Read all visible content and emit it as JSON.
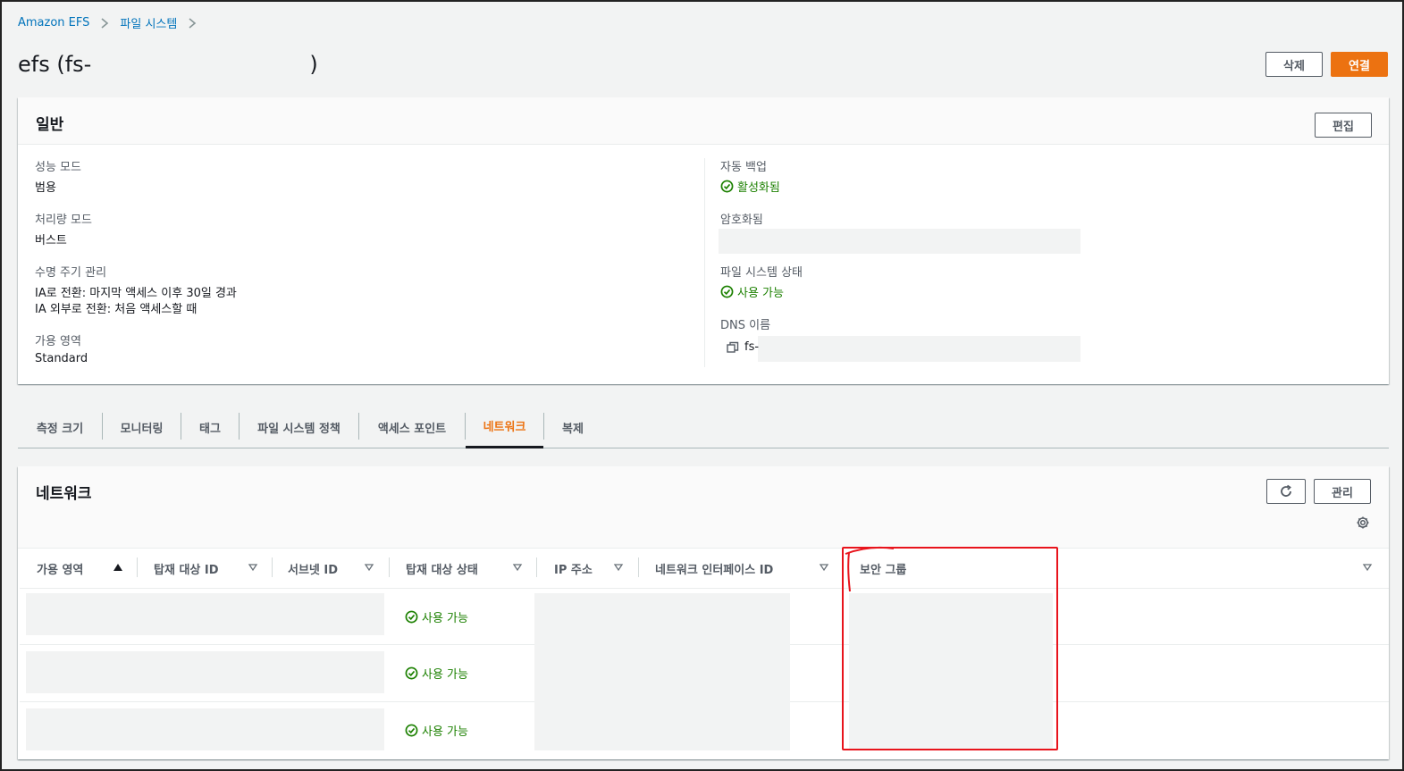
{
  "breadcrumb": {
    "items": [
      "Amazon EFS",
      "파일 시스템"
    ]
  },
  "page": {
    "title_prefix": "efs (fs-",
    "title_suffix": ")"
  },
  "header_buttons": {
    "delete": "삭제",
    "connect": "연결"
  },
  "general": {
    "title": "일반",
    "edit": "편집",
    "left": {
      "performance_mode_label": "성능 모드",
      "performance_mode_value": "범용",
      "throughput_mode_label": "처리량 모드",
      "throughput_mode_value": "버스트",
      "lifecycle_label": "수명 주기 관리",
      "lifecycle_value_1": "IA로 전환: 마지막 액세스 이후 30일 경과",
      "lifecycle_value_2": "IA 외부로 전환: 처음 액세스할 때",
      "az_label": "가용 영역",
      "az_value": "Standard"
    },
    "right": {
      "backup_label": "자동 백업",
      "backup_value": "활성화됨",
      "encrypted_label": "암호화됨",
      "fs_state_label": "파일 시스템 상태",
      "fs_state_value": "사용 가능",
      "dns_label": "DNS 이름",
      "dns_value_prefix": "fs-"
    }
  },
  "tabs": [
    "측정 크기",
    "모니터링",
    "태그",
    "파일 시스템 정책",
    "액세스 포인트",
    "네트워크",
    "복제"
  ],
  "network": {
    "title": "네트워크",
    "manage": "관리",
    "columns": [
      "가용 영역",
      "탑재 대상 ID",
      "서브넷 ID",
      "탑재 대상 상태",
      "IP 주소",
      "네트워크 인터페이스 ID",
      "보안 그룹"
    ],
    "rows": [
      {
        "status": "사용 가능"
      },
      {
        "status": "사용 가능"
      },
      {
        "status": "사용 가능"
      }
    ]
  },
  "colors": {
    "link": "#0073bb",
    "primary": "#ec7211",
    "success": "#1d8102",
    "annotation": "#e8141c"
  }
}
